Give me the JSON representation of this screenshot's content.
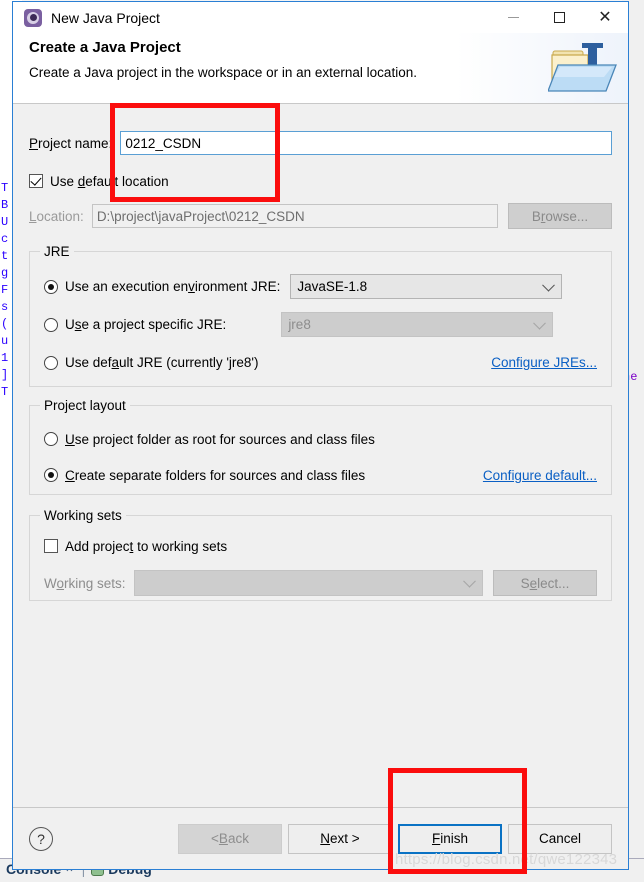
{
  "background": {
    "editor_lines": [
      "T",
      "B",
      "U",
      "c",
      "t",
      "",
      "g",
      "F",
      "s",
      "(",
      "u",
      "1",
      "]",
      "T"
    ],
    "right_code": "ne",
    "bottom_tabs": [
      {
        "label": "Console",
        "close": "✕"
      },
      {
        "label": "Debug"
      }
    ],
    "tab_separator": "|"
  },
  "window": {
    "title": "New Java Project",
    "icon": "eclipse-gear-icon",
    "controls": {
      "minimize": "minimize-icon",
      "maximize": "maximize-icon",
      "close": "✕"
    }
  },
  "header": {
    "title": "Create a Java Project",
    "subtitle": "Create a Java project in the workspace or in an external location.",
    "banner_icon": "java-project-folder-icon"
  },
  "project": {
    "name_label_prefix": "P",
    "name_label_rest": "roject name:",
    "name_value": "0212_CSDN",
    "use_default_location": {
      "label_prefix": "Use ",
      "label_accel": "d",
      "label_rest": "efault location",
      "checked": true
    },
    "location_label_prefix": "L",
    "location_label_rest": "ocation:",
    "location_value": "D:\\project\\javaProject\\0212_CSDN",
    "browse_label_prefix": "B",
    "browse_label_accel": "r",
    "browse_label_rest": "owse..."
  },
  "jre": {
    "group_title": "JRE",
    "option_execution_env": {
      "prefix": "Use an execution en",
      "accel": "v",
      "rest": "ironment JRE:",
      "selected": true
    },
    "execution_env_value": "JavaSE-1.8",
    "option_project_specific": {
      "prefix": "U",
      "accel": "s",
      "rest": "e a project specific JRE:",
      "selected": false
    },
    "project_specific_value": "jre8",
    "option_default_jre": {
      "prefix": "Use def",
      "accel": "a",
      "rest": "ult JRE (currently 'jre8')",
      "selected": false
    },
    "configure_link": "Configure JREs..."
  },
  "layout": {
    "group_title": "Project layout",
    "option_project_folder": {
      "prefix": "",
      "accel": "U",
      "rest": "se project folder as root for sources and class files",
      "selected": false
    },
    "option_separate_folders": {
      "prefix": "",
      "accel": "C",
      "rest": "reate separate folders for sources and class files",
      "selected": true
    },
    "configure_link": "Configure default..."
  },
  "working_sets": {
    "group_title": "Working sets",
    "add_checkbox": {
      "prefix": "Add projec",
      "accel": "t",
      "rest": " to working sets",
      "checked": false
    },
    "label_prefix": "W",
    "label_accel": "o",
    "label_rest": "rking sets:",
    "value": "",
    "select_label_prefix": "S",
    "select_label_accel": "e",
    "select_label_rest": "lect..."
  },
  "footer": {
    "help": "?",
    "back": {
      "prefix": "< ",
      "accel": "B",
      "rest": "ack",
      "enabled": false
    },
    "next": {
      "prefix": "",
      "accel": "N",
      "rest": "ext >",
      "enabled": true
    },
    "finish": {
      "prefix": "",
      "accel": "F",
      "rest": "inish",
      "is_default": true
    },
    "cancel": {
      "prefix": "Cancel",
      "accel": "",
      "rest": "",
      "enabled": true
    }
  },
  "watermark": "https://blog.csdn.net/qwe122343",
  "annotations": {
    "accent_color": "#fb0d0d",
    "project_name_highlight": "project-name-field",
    "finish_highlight": "finish-button"
  }
}
